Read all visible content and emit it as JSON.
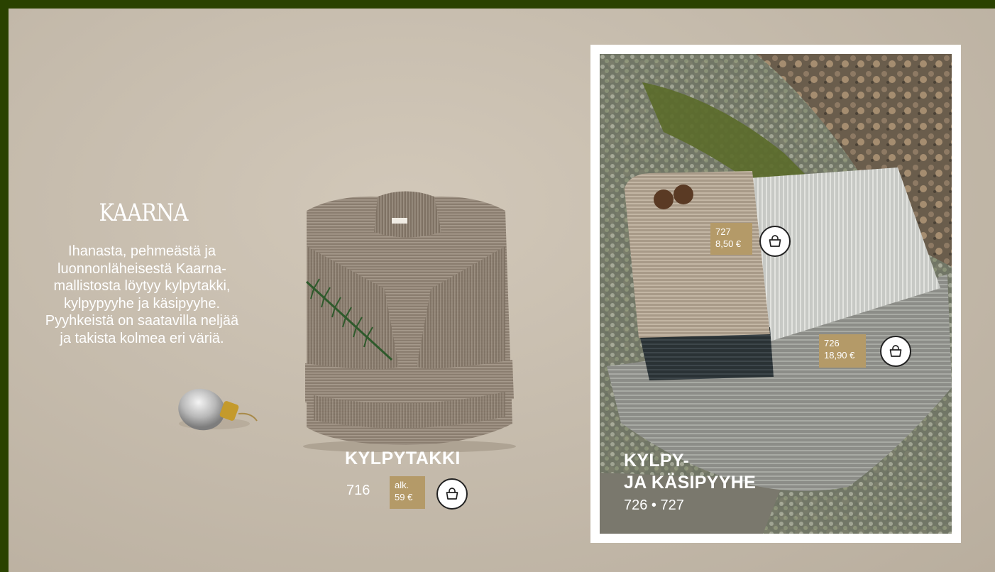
{
  "intro": {
    "title": "KAARNA",
    "text": "Ihanasta, pehmeästä ja luonnonläheisestä Kaarna-mallistosta löytyy kylpytakki, kylpypyyhe ja käsipyyhe. Pyyhkeistä on saatavilla neljää ja takista kolmea eri väriä."
  },
  "robe": {
    "name": "KYLPYTAKKI",
    "code": "716",
    "price_prefix": "alk.",
    "price": "59 €"
  },
  "towels": {
    "name_line1": "KYLPY-",
    "name_line2": "JA KÄSIPYYHE",
    "codes": "726 • 727",
    "items": [
      {
        "code": "727",
        "price": "8,50 €"
      },
      {
        "code": "726",
        "price": "18,90 €"
      }
    ]
  },
  "icons": {
    "cart": "shopping-basket-icon"
  },
  "colors": {
    "border": "#2a4200",
    "price_tag": "#b49a68",
    "background": "#c9bfb0"
  }
}
